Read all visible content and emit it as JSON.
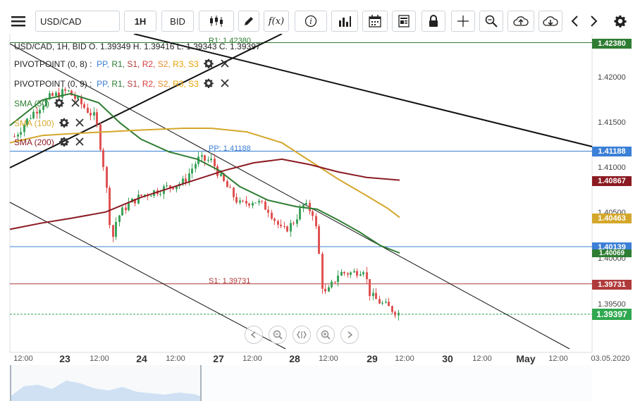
{
  "toolbar": {
    "menu_icon": "hamburger-menu-icon",
    "symbol_value": "USD/CAD",
    "timeframe_label": "1H",
    "price_type_label": "BID",
    "function_label": "f(x)",
    "icons": [
      "candlestick-type-icon",
      "draw-pencil-icon",
      "fx-indicator-icon",
      "info-icon",
      "volume-bars-icon",
      "calendar-icon",
      "news-icon",
      "lock-icon",
      "crosshair-icon",
      "zoom-icon",
      "cloud-upload-icon",
      "cloud-download-icon",
      "chevron-left-icon",
      "chevron-right-icon",
      "gear-icon"
    ]
  },
  "legend": {
    "ohlc": "USD/CAD, 1H, BID   O. 1.39349 H. 1.39416 L. 1.39343 C. 1.39397",
    "pivot1_name": "PIVOTPOINT (0, 8)",
    "pivot2_name": "PIVOTPOINT (0, 9)",
    "pivot_sep": " : ",
    "pivot_labels": [
      "PP,",
      "R1,",
      "S1,",
      "R2,",
      "S2,",
      "R3,",
      "S3"
    ],
    "sma50": "SMA (50)",
    "sma100": "SMA (100)",
    "sma200": "SMA (200)"
  },
  "colors": {
    "up_candle": "#3ca35b",
    "down_candle": "#e05252",
    "sma50": "#2e7d32",
    "sma100": "#d4a72c",
    "sma200": "#8b1a22",
    "pp": "#3b7fd6",
    "r1": "#2e7d32",
    "s1": "#b03a3a",
    "r2": "#d83c3c",
    "s2": "#e58a2b",
    "r3": "#e6a100",
    "s3": "#e6a100",
    "current_price": "#2fa84f"
  },
  "levels": {
    "r1_label": "R1: 1.42380",
    "pp_label": "PP: 1.41188",
    "s1_label": "S1: 1.39731"
  },
  "price_axis": [
    "1.42000",
    "1.41500",
    "1.41000",
    "1.40500",
    "1.40000",
    "1.39500"
  ],
  "price_tags": {
    "r1": "1.42380",
    "pp": "1.41188",
    "sma200": "1.40867",
    "sma100": "1.40463",
    "blue_line": "1.40139",
    "sma50": "1.40069",
    "s1": "1.39731",
    "current": "1.39397"
  },
  "time_axis": {
    "times": [
      "12:00",
      "12:00",
      "12:00",
      "12:00",
      "12:00",
      "12:00",
      "12:00",
      "12:00",
      "03.05.2020"
    ],
    "days": [
      "23",
      "24",
      "27",
      "28",
      "29",
      "30",
      "May"
    ]
  },
  "nav_buttons": [
    "rotate-left-icon",
    "zoom-out-icon",
    "fit-icon",
    "zoom-in-icon",
    "rotate-right-icon"
  ]
}
